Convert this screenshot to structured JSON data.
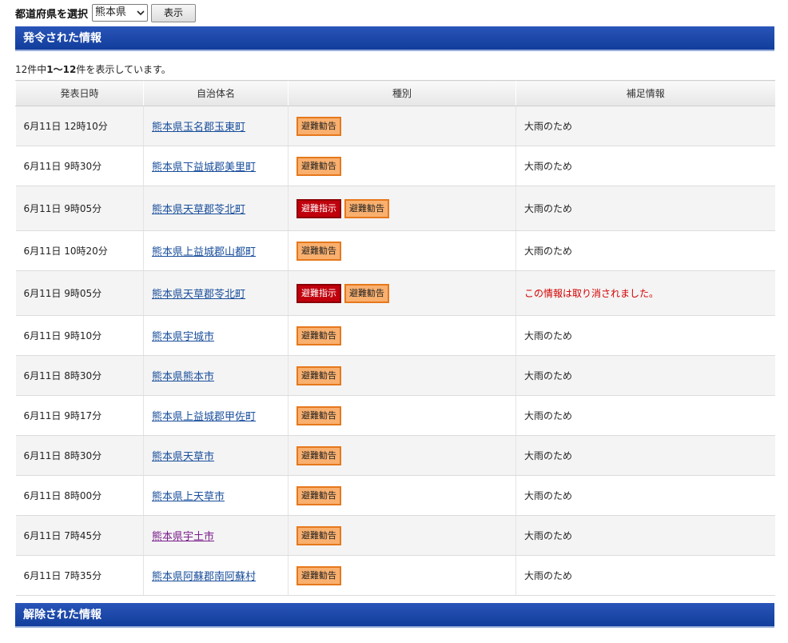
{
  "prefecture_bar": {
    "label": "都道府県を選択",
    "selected": "熊本県",
    "show_button": "表示"
  },
  "issued_section": {
    "title": "発令された情報",
    "count_prefix": "12件中",
    "count_range": "1〜12",
    "count_suffix": "件を表示しています。"
  },
  "table": {
    "headers": [
      "発表日時",
      "自治体名",
      "種別",
      "補足情報"
    ],
    "rows": [
      {
        "datetime": "6月11日 12時10分",
        "municipality": "熊本県玉名郡玉東町",
        "badges": [
          "避難勧告"
        ],
        "note": "大雨のため",
        "note_alert": false,
        "visited": false
      },
      {
        "datetime": "6月11日 9時30分",
        "municipality": "熊本県下益城郡美里町",
        "badges": [
          "避難勧告"
        ],
        "note": "大雨のため",
        "note_alert": false,
        "visited": false
      },
      {
        "datetime": "6月11日 9時05分",
        "municipality": "熊本県天草郡苓北町",
        "badges": [
          "避難指示",
          "避難勧告"
        ],
        "note": "大雨のため",
        "note_alert": false,
        "visited": false
      },
      {
        "datetime": "6月11日 10時20分",
        "municipality": "熊本県上益城郡山都町",
        "badges": [
          "避難勧告"
        ],
        "note": "大雨のため",
        "note_alert": false,
        "visited": false
      },
      {
        "datetime": "6月11日 9時05分",
        "municipality": "熊本県天草郡苓北町",
        "badges": [
          "避難指示",
          "避難勧告"
        ],
        "note": "この情報は取り消されました。",
        "note_alert": true,
        "visited": false
      },
      {
        "datetime": "6月11日 9時10分",
        "municipality": "熊本県宇城市",
        "badges": [
          "避難勧告"
        ],
        "note": "大雨のため",
        "note_alert": false,
        "visited": false
      },
      {
        "datetime": "6月11日 8時30分",
        "municipality": "熊本県熊本市",
        "badges": [
          "避難勧告"
        ],
        "note": "大雨のため",
        "note_alert": false,
        "visited": false
      },
      {
        "datetime": "6月11日 9時17分",
        "municipality": "熊本県上益城郡甲佐町",
        "badges": [
          "避難勧告"
        ],
        "note": "大雨のため",
        "note_alert": false,
        "visited": false
      },
      {
        "datetime": "6月11日 8時30分",
        "municipality": "熊本県天草市",
        "badges": [
          "避難勧告"
        ],
        "note": "大雨のため",
        "note_alert": false,
        "visited": false
      },
      {
        "datetime": "6月11日 8時00分",
        "municipality": "熊本県上天草市",
        "badges": [
          "避難勧告"
        ],
        "note": "大雨のため",
        "note_alert": false,
        "visited": false
      },
      {
        "datetime": "6月11日 7時45分",
        "municipality": "熊本県宇土市",
        "badges": [
          "避難勧告"
        ],
        "note": "大雨のため",
        "note_alert": false,
        "visited": true
      },
      {
        "datetime": "6月11日 7時35分",
        "municipality": "熊本県阿蘇郡南阿蘇村",
        "badges": [
          "避難勧告"
        ],
        "note": "大雨のため",
        "note_alert": false,
        "visited": false
      }
    ]
  },
  "cleared_section": {
    "title": "解除された情報"
  },
  "icons": {
    "dropdown": "chevron-down-icon"
  },
  "colors": {
    "header_blue": "#1a47a8",
    "advisory_fill": "#f9b06f",
    "advisory_border": "#e6781c",
    "order_fill": "#c0000c",
    "alert_text": "#d40000",
    "link": "#1a4f9c",
    "visited_link": "#7a1d8a"
  }
}
